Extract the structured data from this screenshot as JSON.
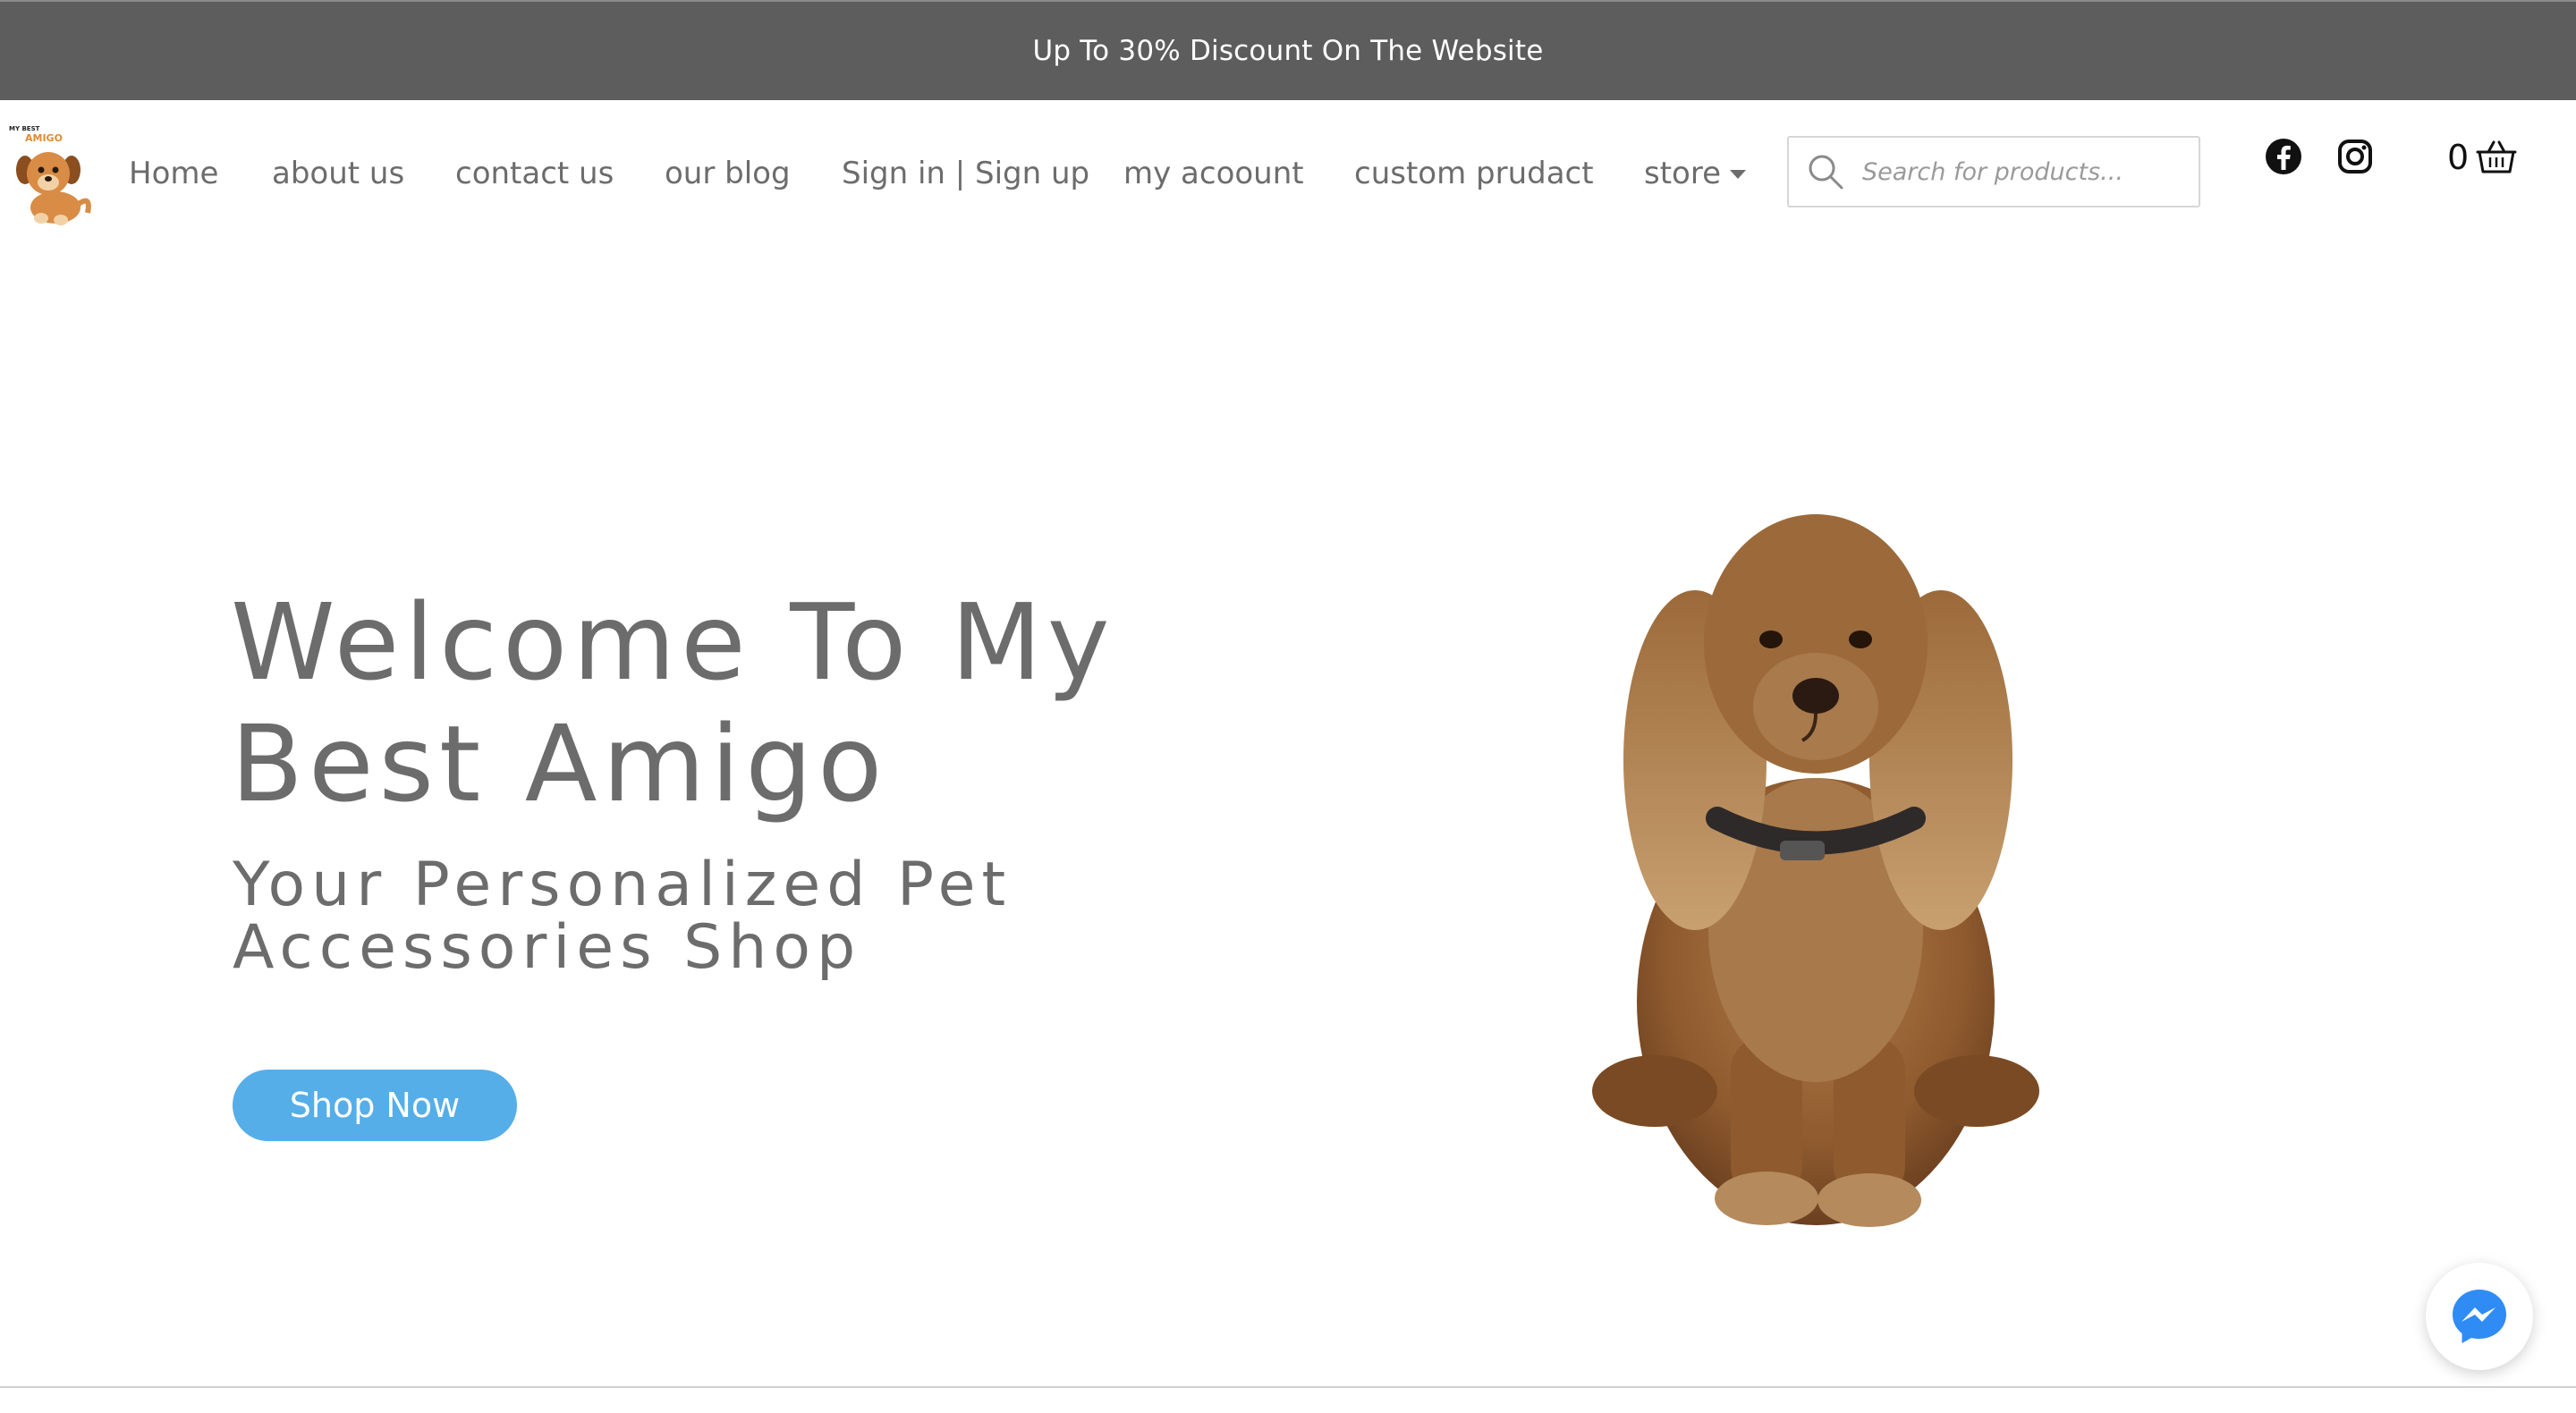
{
  "promo": {
    "text": "Up To 30% Discount On The Website"
  },
  "logo": {
    "top_text": "MY BEST",
    "brand_text": "AMIGO"
  },
  "nav": {
    "items": [
      {
        "label": "Home"
      },
      {
        "label": "about us"
      },
      {
        "label": "contact us"
      },
      {
        "label": "our blog"
      },
      {
        "label": "Sign in | Sign up"
      },
      {
        "label": "my acoount"
      },
      {
        "label": "custom prudact"
      },
      {
        "label": "store"
      }
    ]
  },
  "search": {
    "placeholder": "Search for products..."
  },
  "social": {
    "icons": [
      "facebook-icon",
      "instagram-icon"
    ]
  },
  "cart": {
    "count": "0",
    "icon": "basket-icon"
  },
  "hero": {
    "title": "Welcome To My Best Amigo",
    "subtitle": "Your Personalized Pet Accessories Shop",
    "cta_label": "Shop Now"
  },
  "chat": {
    "icon": "messenger-icon"
  },
  "colors": {
    "promo_bg": "#5d5d5d",
    "text": "#6c6c6c",
    "cta": "#55aee8",
    "messenger": "#2f8cf5"
  }
}
